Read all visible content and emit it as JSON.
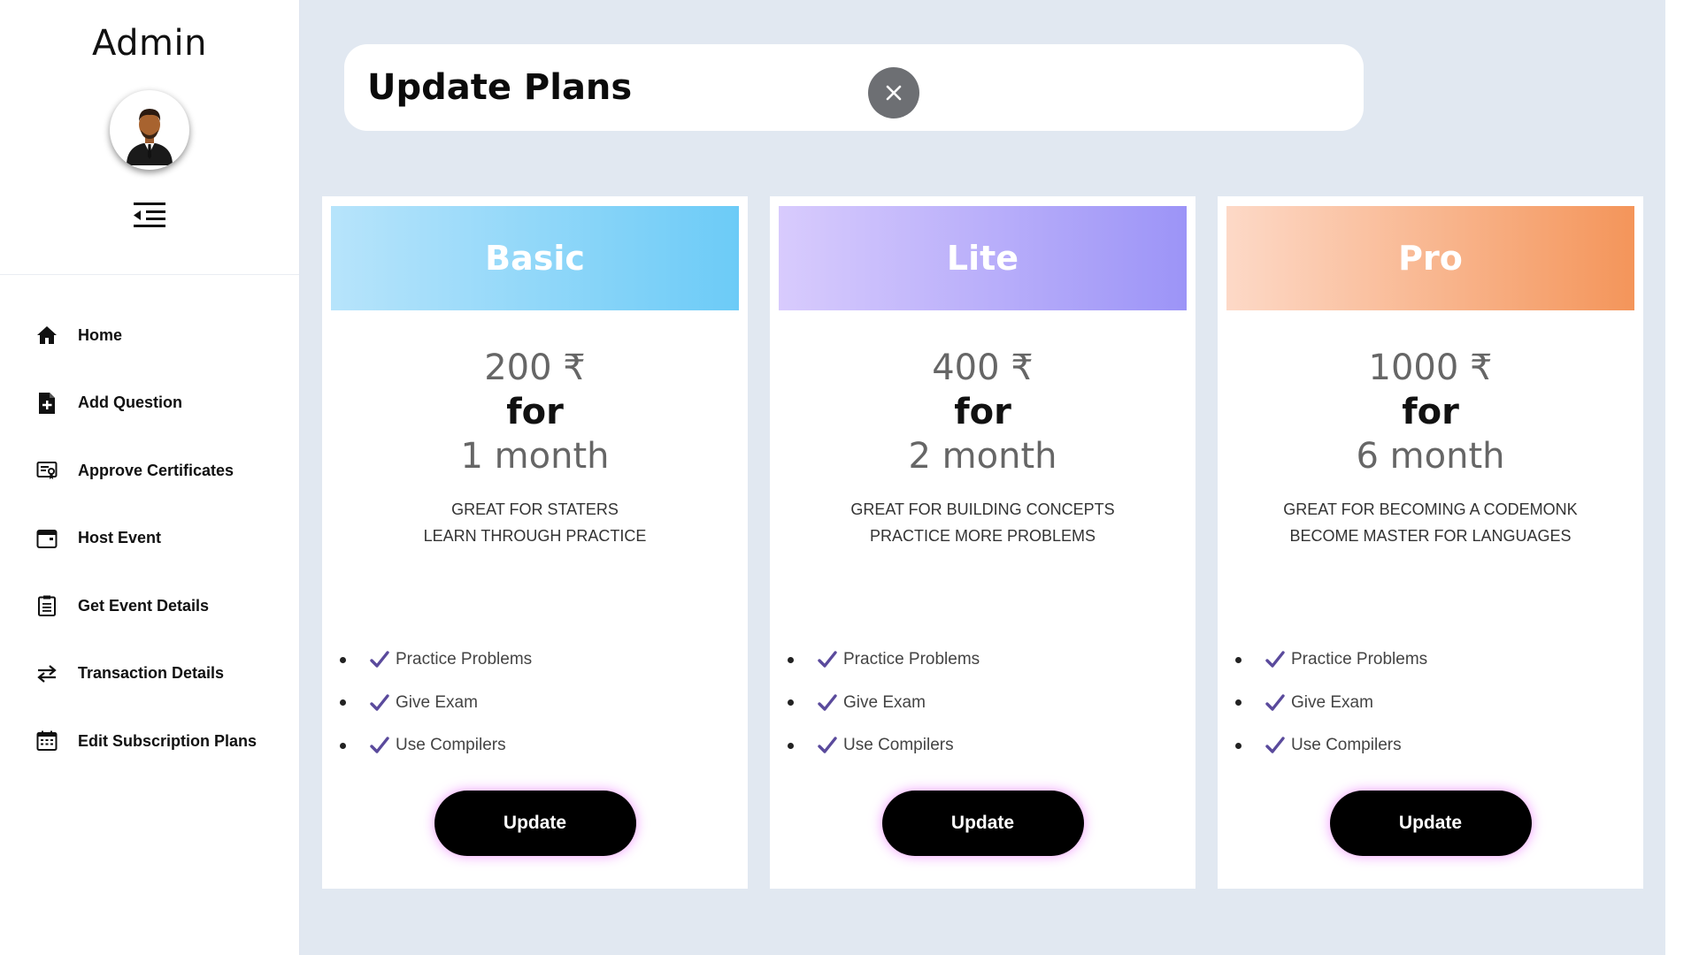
{
  "sidebar": {
    "title": "Admin",
    "avatar_icon": "user-avatar-icon",
    "items": [
      {
        "label": "Home",
        "icon": "home-icon"
      },
      {
        "label": "Add Question",
        "icon": "add-file-icon"
      },
      {
        "label": "Approve Certificates",
        "icon": "certificate-icon"
      },
      {
        "label": "Host Event",
        "icon": "calendar-icon"
      },
      {
        "label": "Get Event Details",
        "icon": "clipboard-list-icon"
      },
      {
        "label": "Transaction Details",
        "icon": "transfer-icon"
      },
      {
        "label": "Edit Subscription Plans",
        "icon": "calendar-grid-icon"
      }
    ]
  },
  "header": {
    "title": "Update Plans",
    "close_icon": "close-icon"
  },
  "plans": [
    {
      "name": "Basic",
      "price": "200 ₹",
      "for": "for",
      "duration": "1 month",
      "desc_line1": "GREAT FOR STATERS",
      "desc_line2": "LEARN THROUGH PRACTICE",
      "features": [
        "Practice Problems",
        "Give Exam",
        "Use Compilers"
      ],
      "button": "Update"
    },
    {
      "name": "Lite",
      "price": "400 ₹",
      "for": "for",
      "duration": "2 month",
      "desc_line1": "GREAT FOR BUILDING CONCEPTS",
      "desc_line2": "PRACTICE MORE PROBLEMS",
      "features": [
        "Practice Problems",
        "Give Exam",
        "Use Compilers"
      ],
      "button": "Update"
    },
    {
      "name": "Pro",
      "price": "1000 ₹",
      "for": "for",
      "duration": "6 month",
      "desc_line1": "GREAT FOR BECOMING A CODEMONK",
      "desc_line2": "BECOME MASTER FOR LANGUAGES",
      "features": [
        "Practice Problems",
        "Give Exam",
        "Use Compilers"
      ],
      "button": "Update"
    }
  ],
  "colors": {
    "main_bg": "#e1e8f1",
    "check": "#5a4a9c",
    "button_glow": "#ec78ff",
    "basic_gradient": [
      "#b7e4fb",
      "#6ccbf7"
    ],
    "lite_gradient": [
      "#d8cbfd",
      "#9c94f7"
    ],
    "pro_gradient": [
      "#fdd9c7",
      "#f4955a"
    ]
  }
}
